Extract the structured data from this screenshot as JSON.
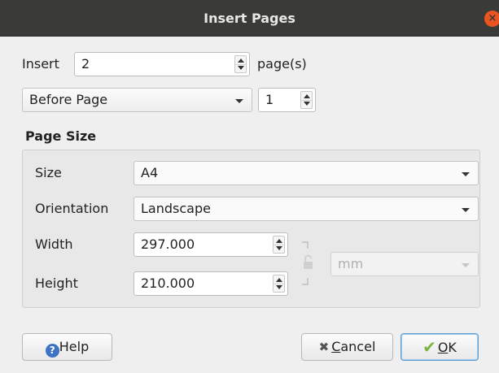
{
  "window": {
    "title": "Insert Pages",
    "close_glyph": "×"
  },
  "insert": {
    "label": "Insert",
    "value": "2",
    "suffix": "page(s)"
  },
  "position": {
    "selected": "Before Page",
    "page_number": "1"
  },
  "page_size": {
    "group_title": "Page Size",
    "size_label": "Size",
    "size_value": "A4",
    "orientation_label": "Orientation",
    "orientation_value": "Landscape",
    "width_label": "Width",
    "width_value": "297.000",
    "height_label": "Height",
    "height_value": "210.000",
    "units_value": "mm",
    "units_enabled": false
  },
  "buttons": {
    "help": "Help",
    "help_icon_glyph": "?",
    "cancel_mnemonic": "C",
    "cancel_rest": "ancel",
    "cancel_icon_glyph": "✖",
    "ok_mnemonic": "O",
    "ok_rest": "K",
    "ok_icon_glyph": "✔"
  },
  "colors": {
    "titlebar": "#3a3a38",
    "close_button": "#e95420",
    "help_icon": "#3d72c4",
    "ok_check": "#7cb342",
    "default_button_border": "#5f9fd6"
  },
  "icons": [
    "close-icon",
    "help-icon",
    "cancel-icon",
    "ok-checkmark-icon",
    "lock-icon",
    "spinbox-arrows-icon",
    "dropdown-arrow-icon"
  ]
}
